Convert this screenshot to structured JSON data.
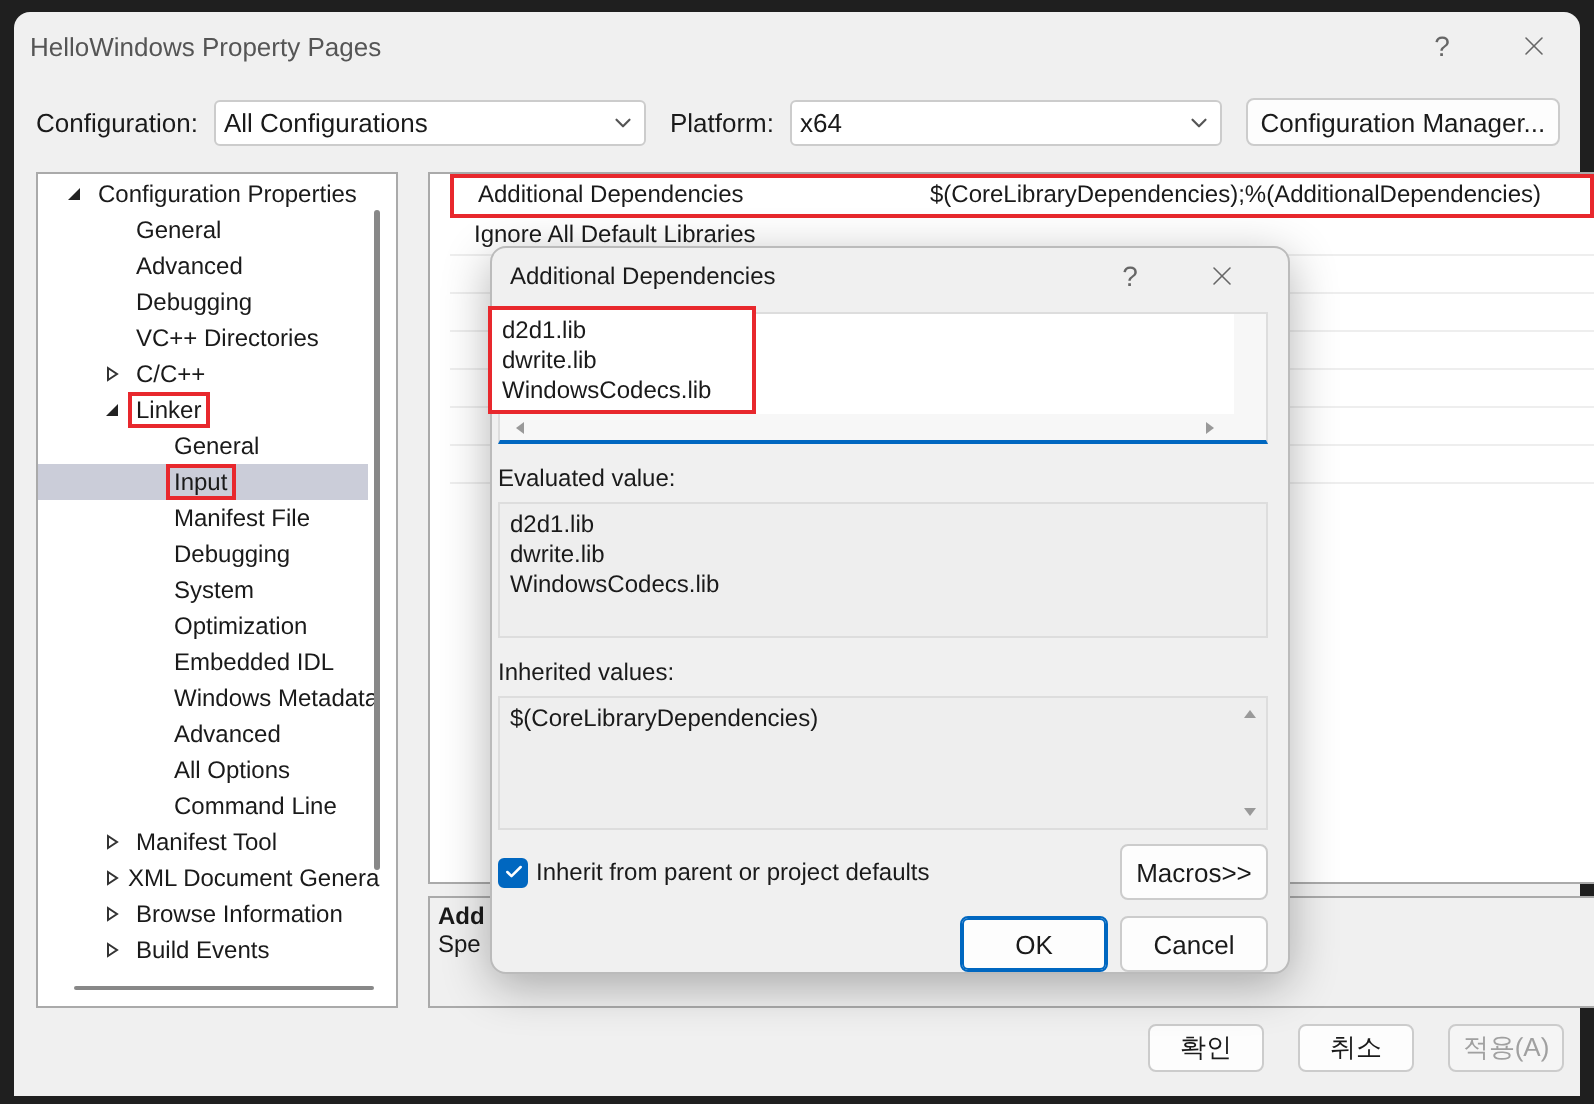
{
  "window": {
    "title": "HelloWindows Property Pages",
    "help": "?"
  },
  "configuration": {
    "label": "Configuration:",
    "value": "All Configurations"
  },
  "platform": {
    "label": "Platform:",
    "value": "x64"
  },
  "configuration_manager_button": "Configuration Manager...",
  "tree": [
    {
      "label": "Configuration Properties",
      "expanded": true,
      "selected": false,
      "highlighted": false,
      "children": [
        {
          "label": "General",
          "selected": false,
          "highlighted": false
        },
        {
          "label": "Advanced",
          "selected": false,
          "highlighted": false
        },
        {
          "label": "Debugging",
          "selected": false,
          "highlighted": false
        },
        {
          "label": "VC++ Directories",
          "selected": false,
          "highlighted": false
        },
        {
          "label": "C/C++",
          "expanded": false,
          "selected": false,
          "highlighted": false
        },
        {
          "label": "Linker",
          "expanded": true,
          "selected": false,
          "highlighted": true,
          "children": [
            {
              "label": "General",
              "selected": false,
              "highlighted": false
            },
            {
              "label": "Input",
              "selected": true,
              "highlighted": true
            },
            {
              "label": "Manifest File",
              "selected": false,
              "highlighted": false
            },
            {
              "label": "Debugging",
              "selected": false,
              "highlighted": false
            },
            {
              "label": "System",
              "selected": false,
              "highlighted": false
            },
            {
              "label": "Optimization",
              "selected": false,
              "highlighted": false
            },
            {
              "label": "Embedded IDL",
              "selected": false,
              "highlighted": false
            },
            {
              "label": "Windows Metadata",
              "selected": false,
              "highlighted": false
            },
            {
              "label": "Advanced",
              "selected": false,
              "highlighted": false
            },
            {
              "label": "All Options",
              "selected": false,
              "highlighted": false
            },
            {
              "label": "Command Line",
              "selected": false,
              "highlighted": false
            }
          ]
        },
        {
          "label": "Manifest Tool",
          "expanded": false,
          "selected": false,
          "highlighted": false
        },
        {
          "label": "XML Document Genera",
          "expanded": false,
          "selected": false,
          "highlighted": false
        },
        {
          "label": "Browse Information",
          "expanded": false,
          "selected": false,
          "highlighted": false
        },
        {
          "label": "Build Events",
          "expanded": false,
          "selected": false,
          "highlighted": false
        }
      ]
    }
  ],
  "property_grid": {
    "rows": [
      {
        "name": "Additional Dependencies",
        "value": "$(CoreLibraryDependencies);%(AdditionalDependencies)",
        "highlighted": true
      },
      {
        "name": "Ignore All Default Libraries",
        "highlighted": false
      }
    ]
  },
  "description": {
    "title": "Add",
    "text": "Spe"
  },
  "edit_dialog": {
    "title": "Additional Dependencies",
    "help": "?",
    "lines": [
      "d2d1.lib",
      "dwrite.lib",
      "WindowsCodecs.lib"
    ],
    "lines_highlighted": true,
    "evaluated_label": "Evaluated value:",
    "evaluated_lines": [
      "d2d1.lib",
      "dwrite.lib",
      "WindowsCodecs.lib"
    ],
    "inherited_label": "Inherited values:",
    "inherited_lines": [
      "$(CoreLibraryDependencies)"
    ],
    "inherit_checkbox": {
      "label": "Inherit from parent or project defaults",
      "checked": true
    },
    "macros_button": "Macros>>",
    "buttons": [
      {
        "label": "OK",
        "default": true
      },
      {
        "label": "Cancel",
        "default": false
      }
    ]
  },
  "buttons": [
    {
      "label": "확인",
      "disabled": false
    },
    {
      "label": "취소",
      "disabled": false
    },
    {
      "label": "적용(A)",
      "disabled": true
    }
  ]
}
